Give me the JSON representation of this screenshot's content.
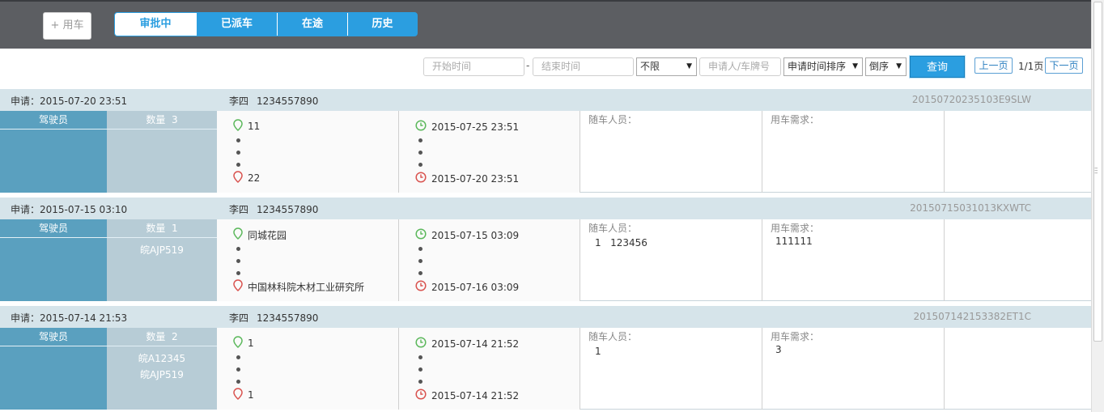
{
  "toolbar": {
    "new_car_label": "+ 用车",
    "tabs": [
      "审批中",
      "已派车",
      "在途",
      "历史"
    ]
  },
  "filter": {
    "start_placeholder": "开始时间",
    "separator": "-",
    "end_placeholder": "结束时间",
    "range_select": "不限",
    "applicant_placeholder": "申请人/车牌号",
    "sort_select": "申请时间排序",
    "order_select": "倒序",
    "query_label": "查询",
    "prev_label": "上一页",
    "page_info": "1/1页",
    "next_label": "下一页"
  },
  "labels": {
    "driver": "驾驶员",
    "count_prefix": "数量",
    "companions": "随车人员：",
    "needs": "用车需求："
  },
  "records": [
    {
      "apply": "申请：2015-07-20 23:51",
      "name": "李四",
      "phone": "1234557890",
      "code": "20150720235103E9SLW",
      "count": "3",
      "plates": [],
      "from": "11",
      "to": "22",
      "start_time": "2015-07-25 23:51",
      "end_time": "2015-07-20 23:51",
      "companions": [],
      "needs": ""
    },
    {
      "apply": "申请：2015-07-15 03:10",
      "name": "李四",
      "phone": "1234557890",
      "code": "20150715031013KXWTC",
      "count": "1",
      "plates": [
        "皖AJP519"
      ],
      "from": "同城花园",
      "to": "中国林科院木材工业研究所",
      "start_time": "2015-07-15 03:09",
      "end_time": "2015-07-16 03:09",
      "companions": [
        "1   123456"
      ],
      "needs": "111111"
    },
    {
      "apply": "申请：2015-07-14 21:53",
      "name": "李四",
      "phone": "1234557890",
      "code": "20150714215338­2ET1C",
      "count": "2",
      "plates": [
        "皖A12345",
        "皖AJP519"
      ],
      "from": "1",
      "to": "1",
      "start_time": "2015-07-14 21:52",
      "end_time": "2015-07-14 21:52",
      "companions": [
        "1"
      ],
      "needs": "3"
    }
  ],
  "colors": {
    "accent": "#2b9ee0",
    "topbar": "#5c5e62",
    "driver_col": "#5aa0bf",
    "count_col": "#b7ccd6",
    "start_green": "#5cb85c",
    "end_red": "#d9534f"
  }
}
